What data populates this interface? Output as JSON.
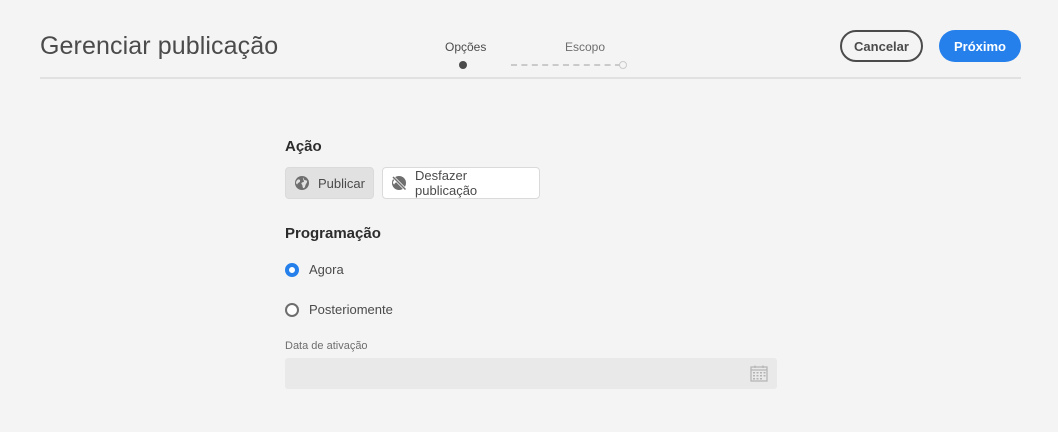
{
  "header": {
    "title": "Gerenciar publicação",
    "steps": [
      {
        "label": "Opções",
        "state": "active"
      },
      {
        "label": "Escopo",
        "state": "inactive"
      }
    ],
    "cancel_label": "Cancelar",
    "next_label": "Próximo"
  },
  "action": {
    "title": "Ação",
    "buttons": [
      {
        "label": "Publicar",
        "icon": "globe-icon",
        "selected": true
      },
      {
        "label": "Desfazer publicação",
        "icon": "globe-off-icon",
        "selected": false
      }
    ]
  },
  "schedule": {
    "title": "Programação",
    "options": [
      {
        "label": "Agora",
        "checked": true
      },
      {
        "label": "Posteriomente",
        "checked": false
      }
    ],
    "date_label": "Data de ativação",
    "date_value": "",
    "date_icon": "calendar-icon"
  },
  "colors": {
    "accent": "#2680eb",
    "background": "#f4f4f4"
  }
}
